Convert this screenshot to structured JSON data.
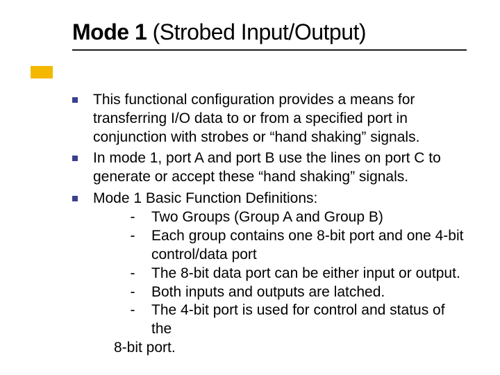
{
  "title": {
    "bold": "Mode 1",
    "plain": " (Strobed Input/Output)"
  },
  "bullets": {
    "b0": "This functional configuration provides a means for transferring I/O data to or from a specified port in conjunction with strobes or “hand shaking” signals.",
    "b1": "In mode 1, port A and port B use the lines on port C to generate or accept these “hand shaking” signals.",
    "b2": "Mode 1 Basic Function Definitions:"
  },
  "subs": {
    "s0": "Two Groups (Group A and Group B)",
    "s1": "Each group contains one 8-bit port and one 4-bit control/data port",
    "s2": "The 8-bit data port can be either input or output.",
    "s3": "Both inputs and outputs are latched.",
    "s4": "The 4-bit port is used for control and status of  the"
  },
  "tail": "8-bit port.",
  "dash": "-"
}
